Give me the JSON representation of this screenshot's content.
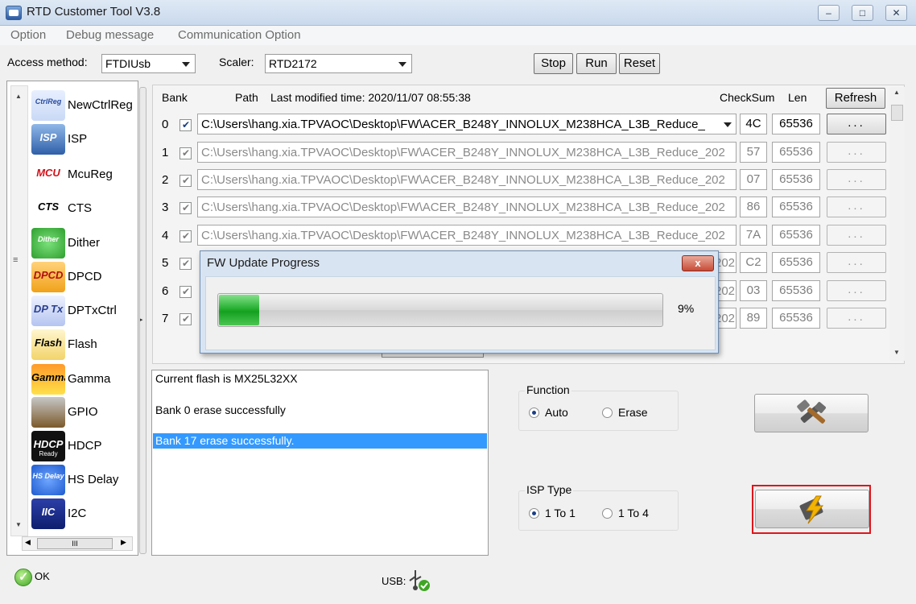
{
  "window": {
    "title": "RTD Customer Tool V3.8"
  },
  "menu": [
    "Option",
    "Debug message",
    "Communication Option"
  ],
  "toolbar": {
    "access_label": "Access method:",
    "access_value": "FTDIUsb",
    "scaler_label": "Scaler:",
    "scaler_value": "RTD2172",
    "stop": "Stop",
    "run": "Run",
    "reset": "Reset"
  },
  "sidebar": {
    "items": [
      {
        "label": "NewCtrlReg",
        "icon": "ctrlreg-icon"
      },
      {
        "label": "ISP",
        "icon": "isp-icon"
      },
      {
        "label": "McuReg",
        "icon": "mcu-icon"
      },
      {
        "label": "CTS",
        "icon": "cts-icon"
      },
      {
        "label": "Dither",
        "icon": "dither-icon"
      },
      {
        "label": "DPCD",
        "icon": "dpcd-icon"
      },
      {
        "label": "DPTxCtrl",
        "icon": "dptx-icon"
      },
      {
        "label": "Flash",
        "icon": "flash-icon"
      },
      {
        "label": "Gamma",
        "icon": "gamma-icon"
      },
      {
        "label": "GPIO",
        "icon": "gpio-icon"
      },
      {
        "label": "HDCP",
        "icon": "hdcp-icon"
      },
      {
        "label": "HS Delay",
        "icon": "hsdelay-icon"
      },
      {
        "label": "I2C",
        "icon": "i2c-icon"
      }
    ],
    "icon_text": {
      "ctrlreg": "CtrlReg",
      "isp": "ISP",
      "mcu": "MCU",
      "cts": "CTS",
      "dither": "Dither",
      "dpcd": "DPCD",
      "dptx": "DP Tx",
      "flash": "Flash",
      "gamma": "Gamma",
      "hdcp": "HDCP",
      "hdcp_sub": "Ready",
      "hsdelay": "HS Delay",
      "i2c": "IIC"
    },
    "hscroll_thumb": "III"
  },
  "bank_panel": {
    "header_bank": "Bank",
    "header_path": "Path",
    "header_modified": "Last modified time: 2020/11/07 08:55:38",
    "header_checksum": "CheckSum",
    "header_len": "Len",
    "refresh": "Refresh",
    "rows": [
      {
        "bank": "0",
        "path": "C:\\Users\\hang.xia.TPVAOC\\Desktop\\FW\\ACER_B248Y_INNOLUX_M238HCA_L3B_Reduce_",
        "checksum": "4C",
        "len": "65536",
        "button": "..."
      },
      {
        "bank": "1",
        "path": "C:\\Users\\hang.xia.TPVAOC\\Desktop\\FW\\ACER_B248Y_INNOLUX_M238HCA_L3B_Reduce_202",
        "checksum": "57",
        "len": "65536",
        "button": "..."
      },
      {
        "bank": "2",
        "path": "C:\\Users\\hang.xia.TPVAOC\\Desktop\\FW\\ACER_B248Y_INNOLUX_M238HCA_L3B_Reduce_202",
        "checksum": "07",
        "len": "65536",
        "button": "..."
      },
      {
        "bank": "3",
        "path": "C:\\Users\\hang.xia.TPVAOC\\Desktop\\FW\\ACER_B248Y_INNOLUX_M238HCA_L3B_Reduce_202",
        "checksum": "86",
        "len": "65536",
        "button": "..."
      },
      {
        "bank": "4",
        "path": "C:\\Users\\hang.xia.TPVAOC\\Desktop\\FW\\ACER_B248Y_INNOLUX_M238HCA_L3B_Reduce_202",
        "checksum": "7A",
        "len": "65536",
        "button": "..."
      },
      {
        "bank": "5",
        "path": "202",
        "checksum": "C2",
        "len": "65536",
        "button": "..."
      },
      {
        "bank": "6",
        "path": "202",
        "checksum": "03",
        "len": "65536",
        "button": "..."
      },
      {
        "bank": "7",
        "path": "202",
        "checksum": "89",
        "len": "65536",
        "button": "..."
      }
    ]
  },
  "log": {
    "lines": [
      "Current flash is MX25L32XX",
      "Bank 0 erase successfully",
      "Bank 17 erase successfully."
    ]
  },
  "function_group": {
    "title": "Function",
    "auto": "Auto",
    "erase": "Erase",
    "selected": "Auto"
  },
  "isp_type_group": {
    "title": "ISP Type",
    "one_to_one": "1 To 1",
    "one_to_four": "1 To 4",
    "selected": "1 To 1"
  },
  "dialog": {
    "title": "FW Update Progress",
    "close": "x",
    "progress": 0.09,
    "percent_text": "9%"
  },
  "status": {
    "ok": "OK",
    "usb": "USB:"
  },
  "colors": {
    "highlight": "#3399ff",
    "red_border": "#e0151b",
    "progress_green": "#22ac2d"
  }
}
